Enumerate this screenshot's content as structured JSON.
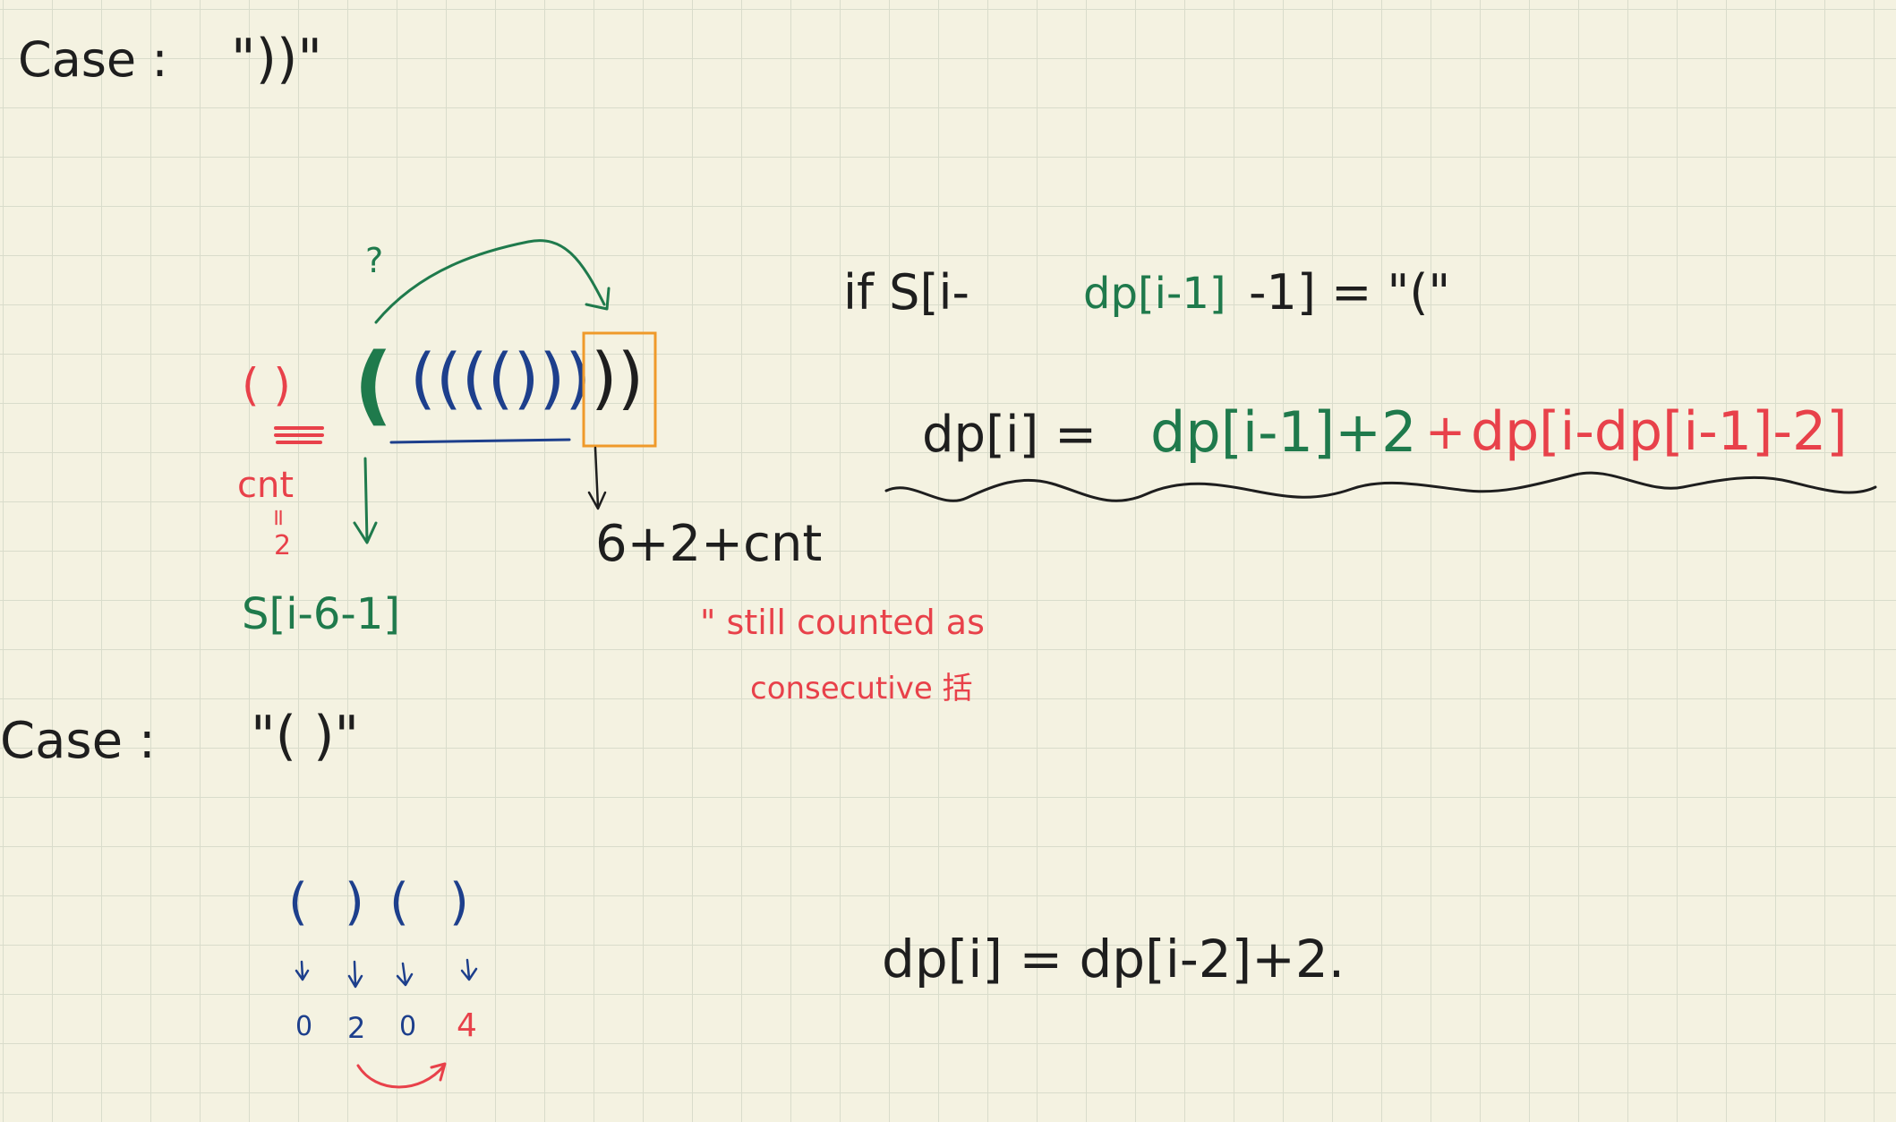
{
  "case1": {
    "label": "Case :",
    "string": "\"))\"",
    "question_mark": "?",
    "open_paren": "(",
    "inner": "(((()))",
    "tail": "))",
    "prev_pair": "( )",
    "cnt_label": "cnt",
    "cnt_eq": "=",
    "cnt_value": "2",
    "index_expr": "S[i-6-1]",
    "result_expr": "6+2+cnt",
    "note_line1": "\" still counted as",
    "note_line2": "consecutive 括",
    "cond_prefix": "if S[i-",
    "cond_dp": "dp[i-1]",
    "cond_suffix": "-1] = \"(\"",
    "formula_lhs": "dp[i] =",
    "formula_mid": "dp[i-1]+2",
    "formula_plus": "+",
    "formula_rhs": "dp[i-dp[i-1]-2]"
  },
  "case2": {
    "label": "Case :",
    "string": "\"( )\"",
    "sequence": [
      "(",
      ")",
      "(",
      ")"
    ],
    "values": [
      "0",
      "2",
      "0",
      "4"
    ],
    "formula": "dp[i] = dp[i-2]+2."
  },
  "ink_colors": {
    "black": "#1e1e1e",
    "red": "#e8414a",
    "green": "#1f7a4c",
    "blue": "#1d3f8c",
    "orange": "#ef9a2a"
  }
}
